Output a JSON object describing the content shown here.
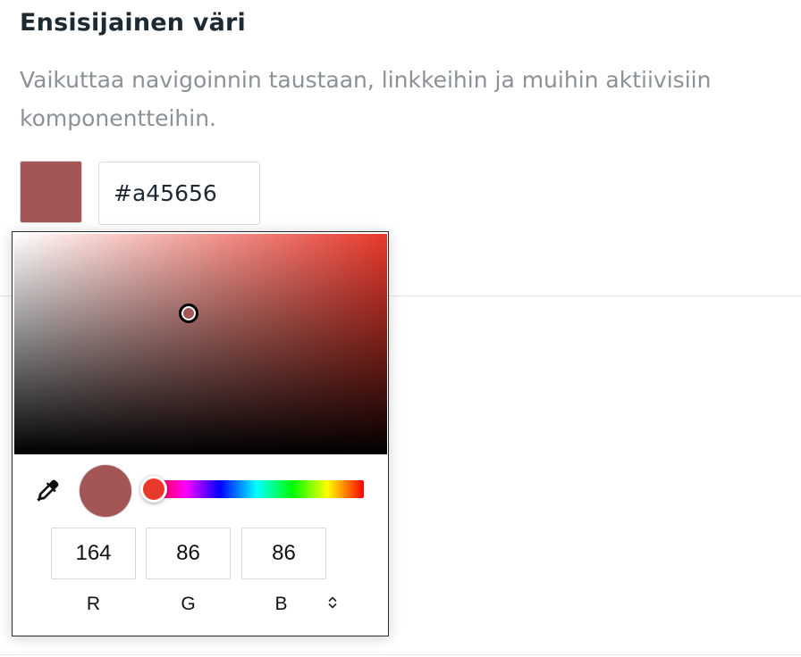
{
  "section": {
    "title": "Ensisijainen väri",
    "description": "Vaikuttaa navigoinnin taustaan, linkkeihin ja muihin aktiivisiin komponentteihin."
  },
  "color": {
    "hex_value": "#a45656",
    "swatch_color": "#a45656",
    "hue_color": "#e8392c"
  },
  "picker": {
    "rgb_fields": [
      {
        "label": "R",
        "value": "164"
      },
      {
        "label": "G",
        "value": "86"
      },
      {
        "label": "B",
        "value": "86"
      }
    ],
    "icons": {
      "eyedropper": "eyedropper-icon",
      "mode_toggle": "chevron-up-down-icon"
    }
  }
}
